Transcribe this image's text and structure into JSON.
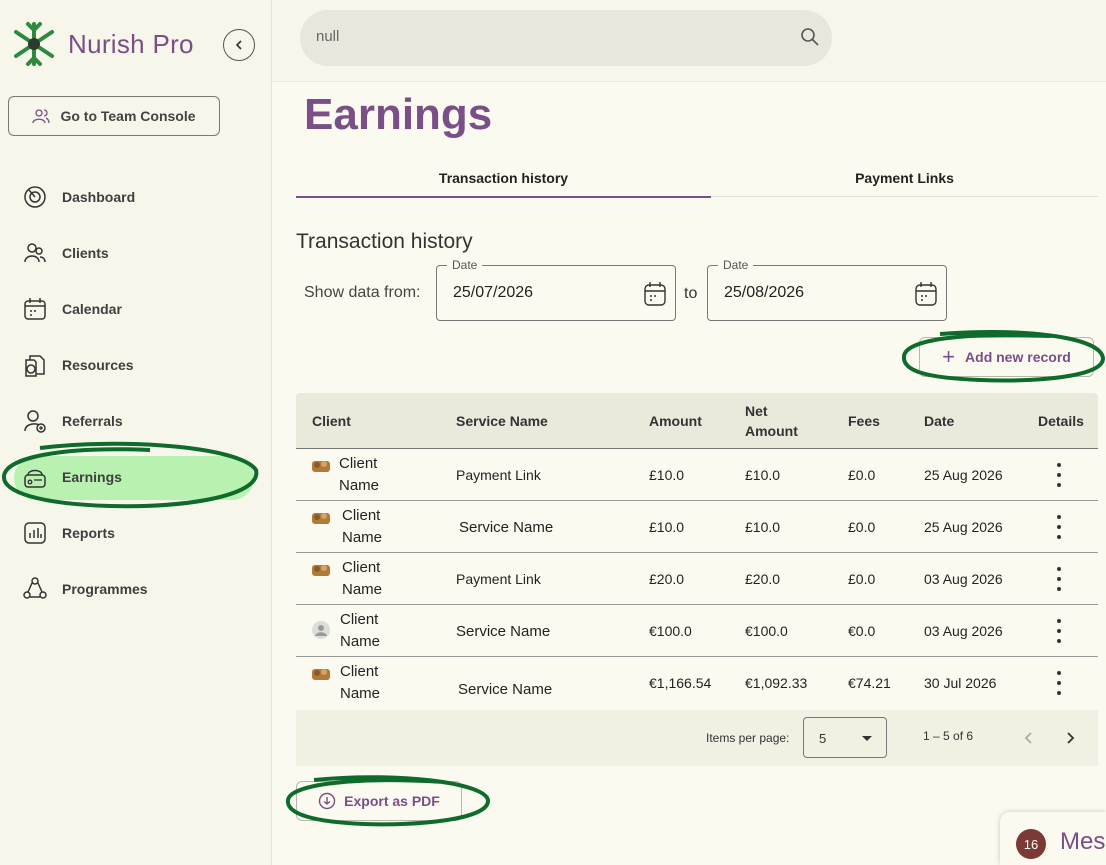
{
  "brand": {
    "name": "Nurish Pro",
    "accent": "#7a4e86",
    "logo_green": "#2e8a3e"
  },
  "sidebar": {
    "team_console_label": "Go to Team Console",
    "items": [
      {
        "label": "Dashboard",
        "icon": "dashboard-icon"
      },
      {
        "label": "Clients",
        "icon": "clients-icon"
      },
      {
        "label": "Calendar",
        "icon": "calendar-icon"
      },
      {
        "label": "Resources",
        "icon": "resources-icon"
      },
      {
        "label": "Referrals",
        "icon": "referrals-icon"
      },
      {
        "label": "Earnings",
        "icon": "earnings-icon",
        "active": true
      },
      {
        "label": "Reports",
        "icon": "reports-icon"
      },
      {
        "label": "Programmes",
        "icon": "programmes-icon"
      }
    ]
  },
  "search": {
    "value": "null"
  },
  "page": {
    "title": "Earnings"
  },
  "tabs": [
    {
      "label": "Transaction history",
      "active": true
    },
    {
      "label": "Payment Links",
      "active": false
    }
  ],
  "filters": {
    "section_title": "Transaction history",
    "show_label": "Show data from:",
    "from": {
      "legend": "Date",
      "value": "25/07/2026"
    },
    "to_label": "to",
    "to": {
      "legend": "Date",
      "value": "25/08/2026"
    }
  },
  "actions": {
    "add_record": "Add new record",
    "export_pdf": "Export as PDF"
  },
  "table": {
    "headers": [
      "Client",
      "Service Name",
      "Amount",
      "Net Amount",
      "Fees",
      "Date",
      "Details"
    ],
    "rows": [
      {
        "client_first": "Client",
        "client_last": "Name",
        "service": "Payment Link",
        "amount": "£10.0",
        "net": "£10.0",
        "fees": "£0.0",
        "date": "25 Aug 2026",
        "avatar": "photo"
      },
      {
        "client_first": "Client",
        "client_last": "Name",
        "service": "Service Name",
        "amount": "£10.0",
        "net": "£10.0",
        "fees": "£0.0",
        "date": "25 Aug 2026",
        "avatar": "photo"
      },
      {
        "client_first": "Client",
        "client_last": "Name",
        "service": "Payment Link",
        "amount": "£20.0",
        "net": "£20.0",
        "fees": "£0.0",
        "date": "03 Aug 2026",
        "avatar": "photo"
      },
      {
        "client_first": "Client",
        "client_last": "Name",
        "service": "Service Name",
        "amount": "€100.0",
        "net": "€100.0",
        "fees": "€0.0",
        "date": "03 Aug 2026",
        "avatar": "default"
      },
      {
        "client_first": "Client",
        "client_last": "Name",
        "service": "Service Name",
        "amount": "€1,166.54",
        "net": "€1,092.33",
        "fees": "€74.21",
        "date": "30 Jul 2026",
        "avatar": "photo"
      }
    ]
  },
  "paginator": {
    "items_per_page_label": "Items per page:",
    "page_size": "5",
    "range": "1 – 5 of 6"
  },
  "messages": {
    "count": "16",
    "label": "Messages"
  }
}
